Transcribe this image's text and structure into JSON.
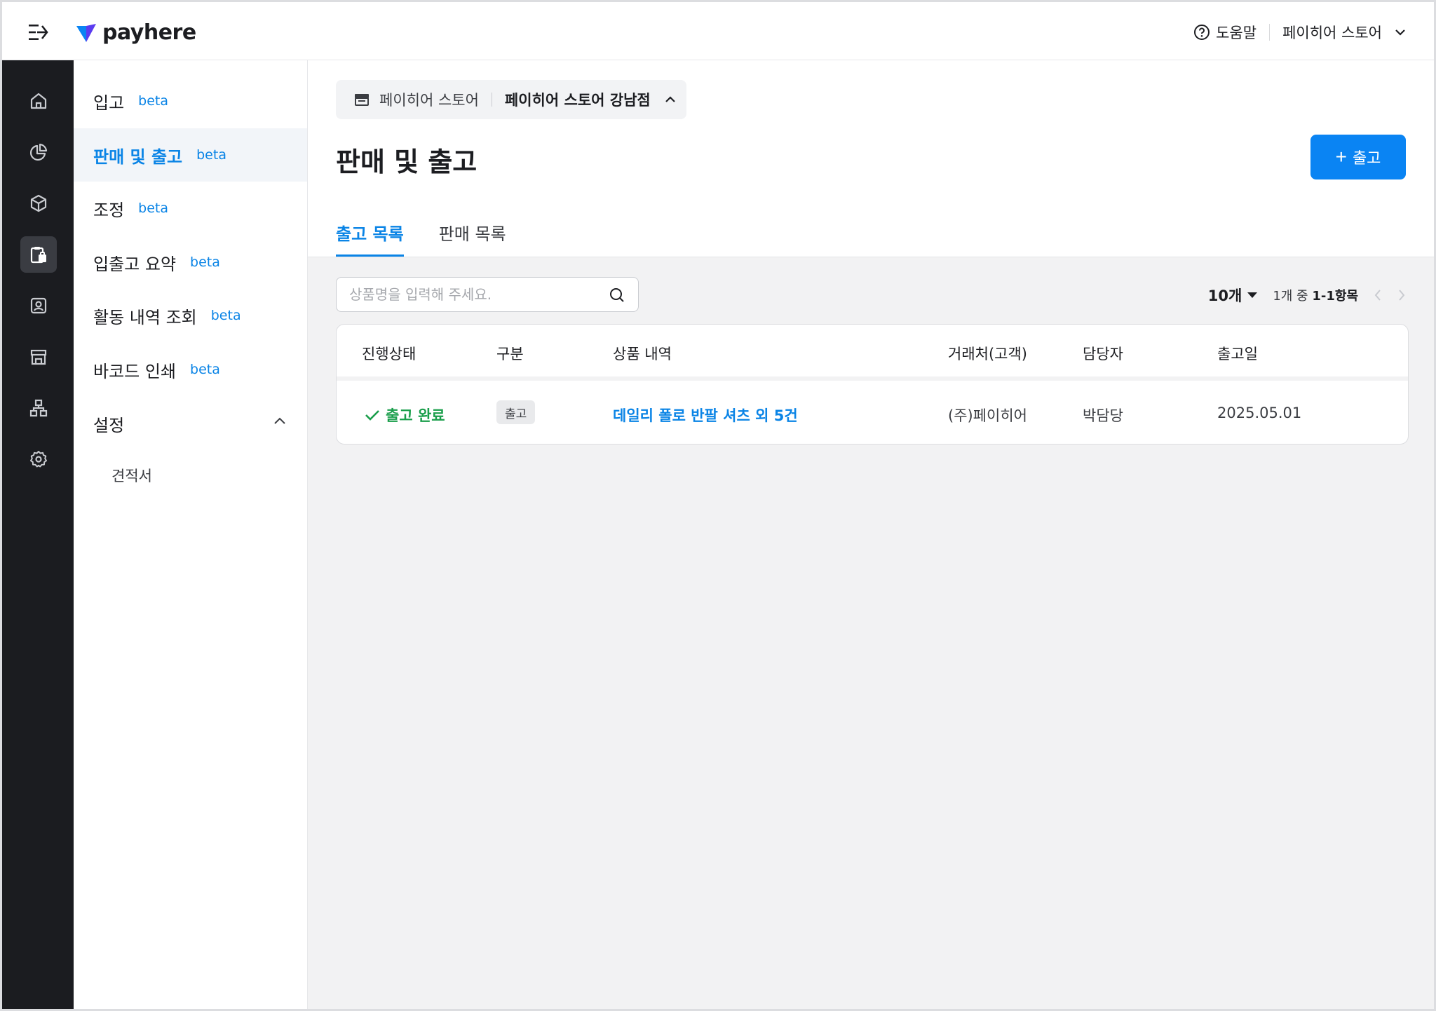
{
  "brand": {
    "name": "payhere",
    "accent": "#0a84f3"
  },
  "topbar": {
    "help_label": "도움말",
    "store_label": "페이히어 스토어"
  },
  "rail": {
    "items": [
      {
        "icon": "home-icon"
      },
      {
        "icon": "pie-chart-icon"
      },
      {
        "icon": "box-icon"
      },
      {
        "icon": "clipboard-icon",
        "active": true
      },
      {
        "icon": "contact-icon"
      },
      {
        "icon": "store-icon"
      },
      {
        "icon": "org-chart-icon"
      },
      {
        "icon": "gear-icon"
      }
    ]
  },
  "sidebar": {
    "items": [
      {
        "label": "입고",
        "badge": "beta"
      },
      {
        "label": "판매 및 출고",
        "badge": "beta",
        "active": true
      },
      {
        "label": "조정",
        "badge": "beta"
      },
      {
        "label": "입출고 요약",
        "badge": "beta"
      },
      {
        "label": "활동 내역 조회",
        "badge": "beta"
      },
      {
        "label": "바코드 인쇄",
        "badge": "beta"
      }
    ],
    "section": {
      "label": "설정",
      "expanded": true
    },
    "sub_items": [
      {
        "label": "견적서"
      }
    ]
  },
  "main": {
    "store_selector": {
      "parent": "페이히어 스토어",
      "branch": "페이히어 스토어 강남점"
    },
    "title": "판매 및 출고",
    "add_button_label": "출고",
    "tabs": [
      {
        "label": "출고 목록",
        "active": true
      },
      {
        "label": "판매 목록"
      }
    ],
    "search": {
      "placeholder": "상품명을 입력해 주세요.",
      "value": ""
    },
    "pager": {
      "per_page": "10개",
      "range_prefix": "1개 중",
      "range": "1-1항목"
    },
    "table": {
      "columns": [
        "진행상태",
        "구분",
        "상품 내역",
        "거래처(고객)",
        "담당자",
        "출고일"
      ],
      "rows": [
        {
          "status": "출고 완료",
          "type": "출고",
          "product": "데일리 폴로 반팔 셔츠 외 5건",
          "client": "(주)페이히어",
          "manager": "박담당",
          "date": "2025.05.01"
        }
      ]
    }
  }
}
